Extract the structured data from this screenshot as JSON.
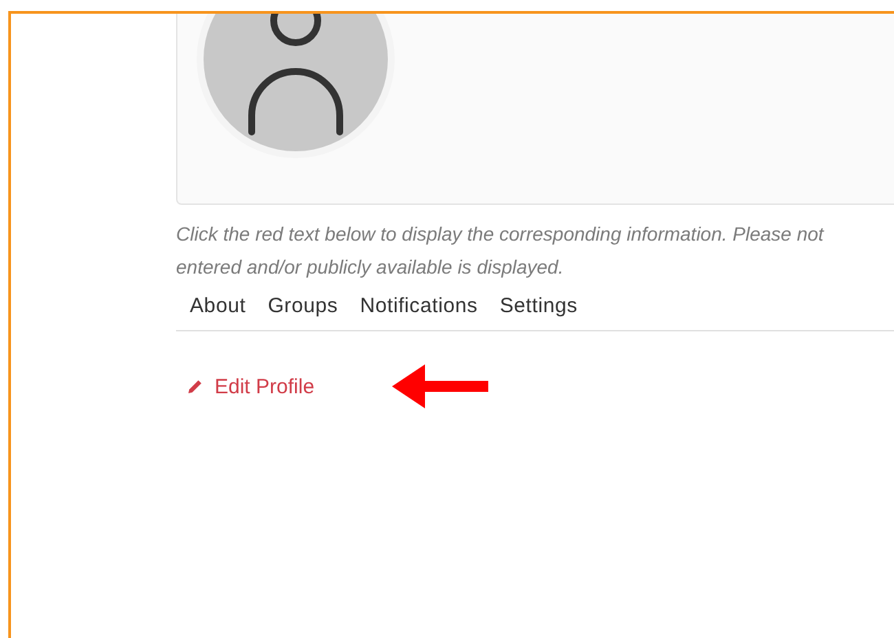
{
  "profile": {
    "avatar": {
      "kind": "placeholder"
    }
  },
  "instructions": [
    "Click the red text below to display the corresponding information. Please not",
    "entered and/or publicly available is displayed."
  ],
  "tabs": [
    {
      "label": "About"
    },
    {
      "label": "Groups"
    },
    {
      "label": "Notifications"
    },
    {
      "label": "Settings"
    }
  ],
  "edit_link": {
    "label": "Edit Profile"
  }
}
